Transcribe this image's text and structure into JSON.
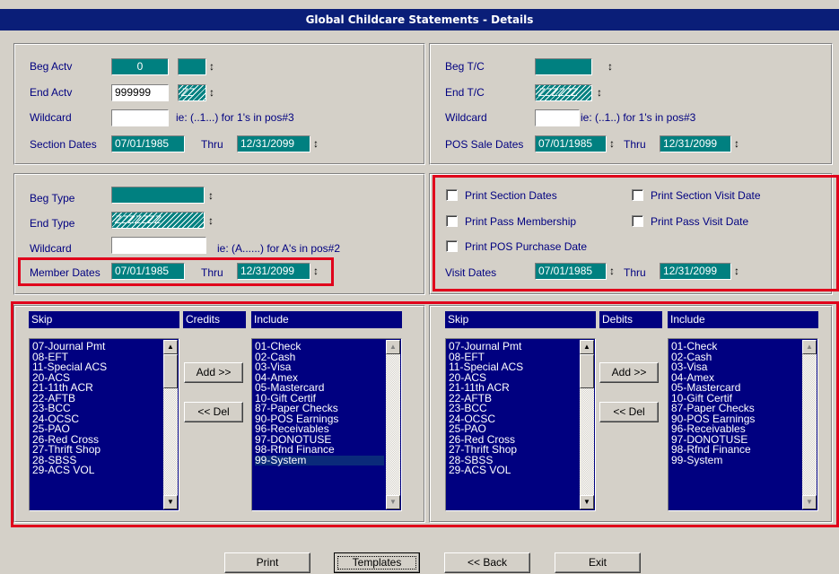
{
  "window": {
    "title": "Global Childcare Statements - Details"
  },
  "activity": {
    "beg_label": "Beg Actv",
    "beg_value": "0",
    "beg_suffix": "",
    "end_label": "End Actv",
    "end_value": "999999",
    "end_suffix": "ZZ",
    "wildcard_label": "Wildcard",
    "wildcard_value": "",
    "wildcard_hint": "ie: (..1...) for 1's in pos#3",
    "dates_label": "Section Dates",
    "date_from": "07/01/1985",
    "thru_label": "Thru",
    "date_to": "12/31/2099"
  },
  "tc": {
    "beg_label": "Beg T/C",
    "beg_value": "",
    "end_label": "End T/C",
    "end_value": "ZZZZZZ",
    "wildcard_label": "Wildcard",
    "wildcard_value": "",
    "wildcard_hint": "ie: (..1..) for 1's in pos#3",
    "dates_label": "POS Sale Dates",
    "date_from": "07/01/1985",
    "thru_label": "Thru",
    "date_to": "12/31/2099"
  },
  "type": {
    "beg_label": "Beg Type",
    "beg_value": "",
    "end_label": "End Type",
    "end_value": "ZZZZZZZ",
    "wildcard_label": "Wildcard",
    "wildcard_value": "",
    "wildcard_hint": "ie: (A......) for A's in pos#2",
    "dates_label": "Member Dates",
    "date_from": "07/01/1985",
    "thru_label": "Thru",
    "date_to": "12/31/2099"
  },
  "options": {
    "print_section_dates": "Print Section Dates",
    "print_section_visit_date": "Print Section Visit Date",
    "print_pass_membership": "Print Pass Membership",
    "print_pass_visit_date": "Print Pass Visit Date",
    "print_pos_purchase_date": "Print POS Purchase Date",
    "visit_dates_label": "Visit Dates",
    "date_from": "07/01/1985",
    "thru_label": "Thru",
    "date_to": "12/31/2099"
  },
  "credits": {
    "skip_header": "Skip",
    "mid_header": "Credits",
    "include_header": "Include",
    "add_label": "Add >>",
    "del_label": "<< Del",
    "skip_items": [
      "07-Journal Pmt",
      "08-EFT",
      "11-Special ACS",
      "20-ACS",
      "21-11th ACR",
      "22-AFTB",
      "23-BCC",
      "24-OCSC",
      "25-PAO",
      "26-Red Cross",
      "27-Thrift Shop",
      "28-SBSS",
      "29-ACS VOL"
    ],
    "include_items": [
      "01-Check",
      "02-Cash",
      "03-Visa",
      "04-Amex",
      "05-Mastercard",
      "10-Gift Certif",
      "87-Paper Checks",
      "90-POS Earnings",
      "96-Receivables",
      "97-DONOTUSE",
      "98-Rfnd Finance",
      "99-System"
    ]
  },
  "debits": {
    "skip_header": "Skip",
    "mid_header": "Debits",
    "include_header": "Include",
    "add_label": "Add >>",
    "del_label": "<< Del",
    "skip_items": [
      "07-Journal Pmt",
      "08-EFT",
      "11-Special ACS",
      "20-ACS",
      "21-11th ACR",
      "22-AFTB",
      "23-BCC",
      "24-OCSC",
      "25-PAO",
      "26-Red Cross",
      "27-Thrift Shop",
      "28-SBSS",
      "29-ACS VOL"
    ],
    "include_items": [
      "01-Check",
      "02-Cash",
      "03-Visa",
      "04-Amex",
      "05-Mastercard",
      "10-Gift Certif",
      "87-Paper Checks",
      "90-POS Earnings",
      "96-Receivables",
      "97-DONOTUSE",
      "98-Rfnd Finance",
      "99-System"
    ]
  },
  "buttons": {
    "print": "Print",
    "templates": "Templates",
    "back": "<< Back",
    "exit": "Exit"
  },
  "colors": {
    "title_bar": "#0a1e78",
    "field": "#008080",
    "list": "#000080",
    "highlight": "#e0001b"
  }
}
